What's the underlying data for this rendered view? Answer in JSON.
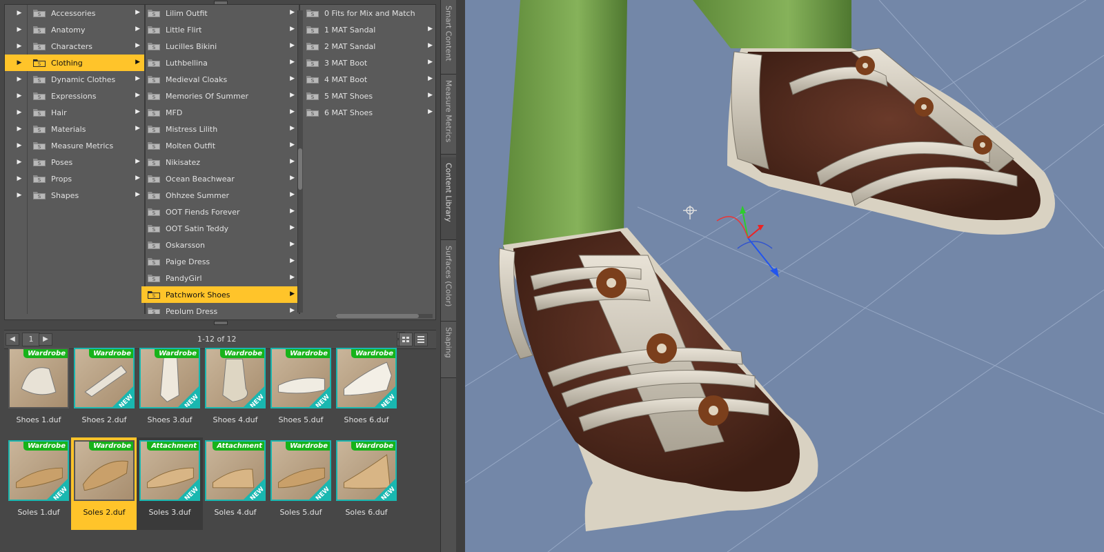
{
  "content_browser": {
    "root_arrow_glyph": "▶",
    "categories": [
      {
        "label": "Accessories",
        "has_arrow": true,
        "selected": false
      },
      {
        "label": "Anatomy",
        "has_arrow": true,
        "selected": false
      },
      {
        "label": "Characters",
        "has_arrow": true,
        "selected": false
      },
      {
        "label": "Clothing",
        "has_arrow": true,
        "selected": true
      },
      {
        "label": "Dynamic Clothes",
        "has_arrow": true,
        "selected": false
      },
      {
        "label": "Expressions",
        "has_arrow": true,
        "selected": false
      },
      {
        "label": "Hair",
        "has_arrow": true,
        "selected": false
      },
      {
        "label": "Materials",
        "has_arrow": true,
        "selected": false
      },
      {
        "label": "Measure Metrics",
        "has_arrow": false,
        "selected": false
      },
      {
        "label": "Poses",
        "has_arrow": true,
        "selected": false
      },
      {
        "label": "Props",
        "has_arrow": true,
        "selected": false
      },
      {
        "label": "Shapes",
        "has_arrow": true,
        "selected": false
      }
    ],
    "clothing_items": [
      {
        "label": "Lilim Outfit",
        "has_arrow": true,
        "selected": false
      },
      {
        "label": "Little Flirt",
        "has_arrow": true,
        "selected": false
      },
      {
        "label": "Lucilles Bikini",
        "has_arrow": true,
        "selected": false
      },
      {
        "label": "Luthbellina",
        "has_arrow": true,
        "selected": false
      },
      {
        "label": "Medieval Cloaks",
        "has_arrow": true,
        "selected": false
      },
      {
        "label": "Memories Of Summer",
        "has_arrow": true,
        "selected": false
      },
      {
        "label": "MFD",
        "has_arrow": true,
        "selected": false
      },
      {
        "label": "Mistress Lilith",
        "has_arrow": true,
        "selected": false
      },
      {
        "label": "Molten Outfit",
        "has_arrow": true,
        "selected": false
      },
      {
        "label": "Nikisatez",
        "has_arrow": true,
        "selected": false
      },
      {
        "label": "Ocean Beachwear",
        "has_arrow": true,
        "selected": false
      },
      {
        "label": "Ohhzee Summer",
        "has_arrow": true,
        "selected": false
      },
      {
        "label": "OOT Fiends Forever",
        "has_arrow": true,
        "selected": false
      },
      {
        "label": "OOT Satin Teddy",
        "has_arrow": true,
        "selected": false
      },
      {
        "label": "Oskarsson",
        "has_arrow": true,
        "selected": false
      },
      {
        "label": "Paige Dress",
        "has_arrow": true,
        "selected": false
      },
      {
        "label": "PandyGirl",
        "has_arrow": true,
        "selected": false
      },
      {
        "label": "Patchwork Shoes",
        "has_arrow": true,
        "selected": true
      },
      {
        "label": "Peplum Dress",
        "has_arrow": true,
        "selected": false
      }
    ],
    "patchwork_items": [
      {
        "label": "0 Fits for Mix and Match",
        "has_arrow": false,
        "selected": false
      },
      {
        "label": "1 MAT Sandal",
        "has_arrow": true,
        "selected": false
      },
      {
        "label": "2 MAT Sandal",
        "has_arrow": true,
        "selected": false
      },
      {
        "label": "3 MAT Boot",
        "has_arrow": true,
        "selected": false
      },
      {
        "label": "4 MAT Boot",
        "has_arrow": true,
        "selected": false
      },
      {
        "label": "5 MAT Shoes",
        "has_arrow": true,
        "selected": false
      },
      {
        "label": "6 MAT Shoes",
        "has_arrow": true,
        "selected": false
      }
    ]
  },
  "pager": {
    "page": "1",
    "count_text": "1-12 of 12",
    "prev_glyph": "◀",
    "next_glyph": "▶",
    "zoom_in": "+",
    "zoom_out": "-"
  },
  "assets": [
    {
      "name": "Shoes 1.duf",
      "badge": "Wardrobe",
      "is_new": false,
      "state": "normal"
    },
    {
      "name": "Shoes 2.duf",
      "badge": "Wardrobe",
      "is_new": true,
      "state": "normal"
    },
    {
      "name": "Shoes 3.duf",
      "badge": "Wardrobe",
      "is_new": true,
      "state": "normal"
    },
    {
      "name": "Shoes 4.duf",
      "badge": "Wardrobe",
      "is_new": true,
      "state": "normal"
    },
    {
      "name": "Shoes 5.duf",
      "badge": "Wardrobe",
      "is_new": true,
      "state": "normal"
    },
    {
      "name": "Shoes 6.duf",
      "badge": "Wardrobe",
      "is_new": true,
      "state": "normal"
    },
    {
      "name": "Soles 1.duf",
      "badge": "Wardrobe",
      "is_new": true,
      "state": "normal"
    },
    {
      "name": "Soles 2.duf",
      "badge": "Wardrobe",
      "is_new": false,
      "state": "selected"
    },
    {
      "name": "Soles 3.duf",
      "badge": "Attachment",
      "is_new": true,
      "state": "hover"
    },
    {
      "name": "Soles 4.duf",
      "badge": "Attachment",
      "is_new": true,
      "state": "normal"
    },
    {
      "name": "Soles 5.duf",
      "badge": "Wardrobe",
      "is_new": true,
      "state": "normal"
    },
    {
      "name": "Soles 6.duf",
      "badge": "Wardrobe",
      "is_new": true,
      "state": "normal"
    }
  ],
  "new_label": "NEW",
  "side_tabs": [
    {
      "label": "Smart Content",
      "active": false
    },
    {
      "label": "Measure Metrics",
      "active": false
    },
    {
      "label": "Content Library",
      "active": true
    },
    {
      "label": "Surfaces (Color)",
      "active": false
    },
    {
      "label": "Shaping",
      "active": false
    }
  ],
  "viewport": {
    "subject": "3D render of feet in white strappy sandals with green leggings",
    "background_color": "#7387a8"
  },
  "colors": {
    "selection": "#ffc42a",
    "badge_green": "#17b31a",
    "new_teal": "#19b7b0",
    "panel": "#5a5a5a"
  }
}
